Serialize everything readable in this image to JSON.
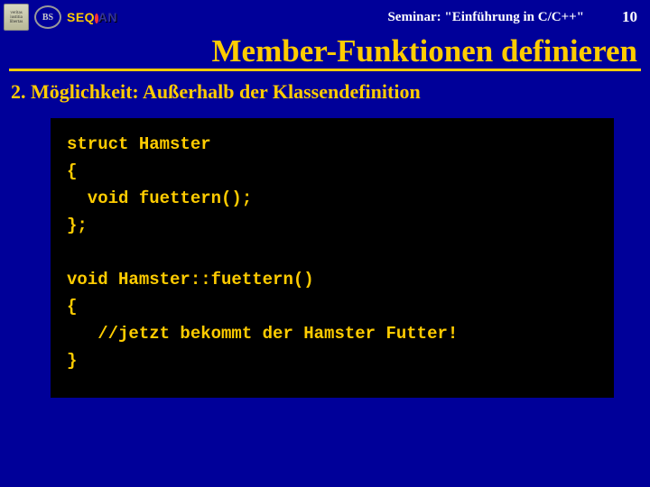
{
  "header": {
    "logo1_alt": "veritas iustitia libertas",
    "logo2_alt": "BS",
    "logo3_seq": "SEQ",
    "logo3_an": "AN",
    "seminar": "Seminar: \"Einführung in C/C++\"",
    "page": "10"
  },
  "title": "Member-Funktionen definieren",
  "subhead": "2.  Möglichkeit: Außerhalb der Klassendefinition",
  "code": "struct Hamster\n{\n  void fuettern();\n};\n\nvoid Hamster::fuettern()\n{\n   //jetzt bekommt der Hamster Futter!\n}"
}
